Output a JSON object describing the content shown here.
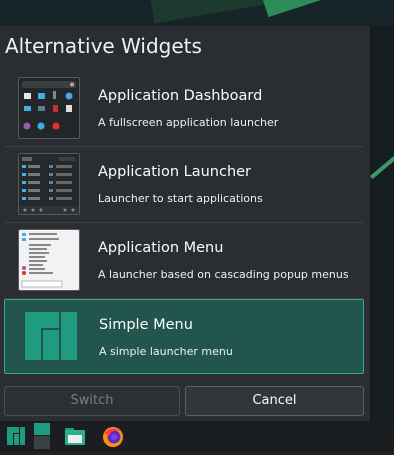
{
  "dialog": {
    "title": "Alternative Widgets",
    "items": [
      {
        "name": "Application Dashboard",
        "description": "A fullscreen application launcher",
        "thumb_icon": "dashboard-thumbnail"
      },
      {
        "name": "Application Launcher",
        "description": "Launcher to start applications",
        "thumb_icon": "launcher-thumbnail"
      },
      {
        "name": "Application Menu",
        "description": "A launcher based on cascading popup menus",
        "thumb_icon": "menu-thumbnail"
      },
      {
        "name": "Simple Menu",
        "description": "A simple launcher menu",
        "thumb_icon": "manjaro-logo",
        "selected": true
      }
    ],
    "buttons": {
      "switch": "Switch",
      "cancel": "Cancel"
    }
  },
  "taskbar": {
    "icons": [
      "manjaro-logo-icon",
      "simple-menu-icon",
      "file-manager-icon",
      "firefox-icon"
    ]
  },
  "colors": {
    "accent": "#3ba890",
    "selected_bg": "#22554e",
    "manjaro_green": "#1f9c7f"
  }
}
